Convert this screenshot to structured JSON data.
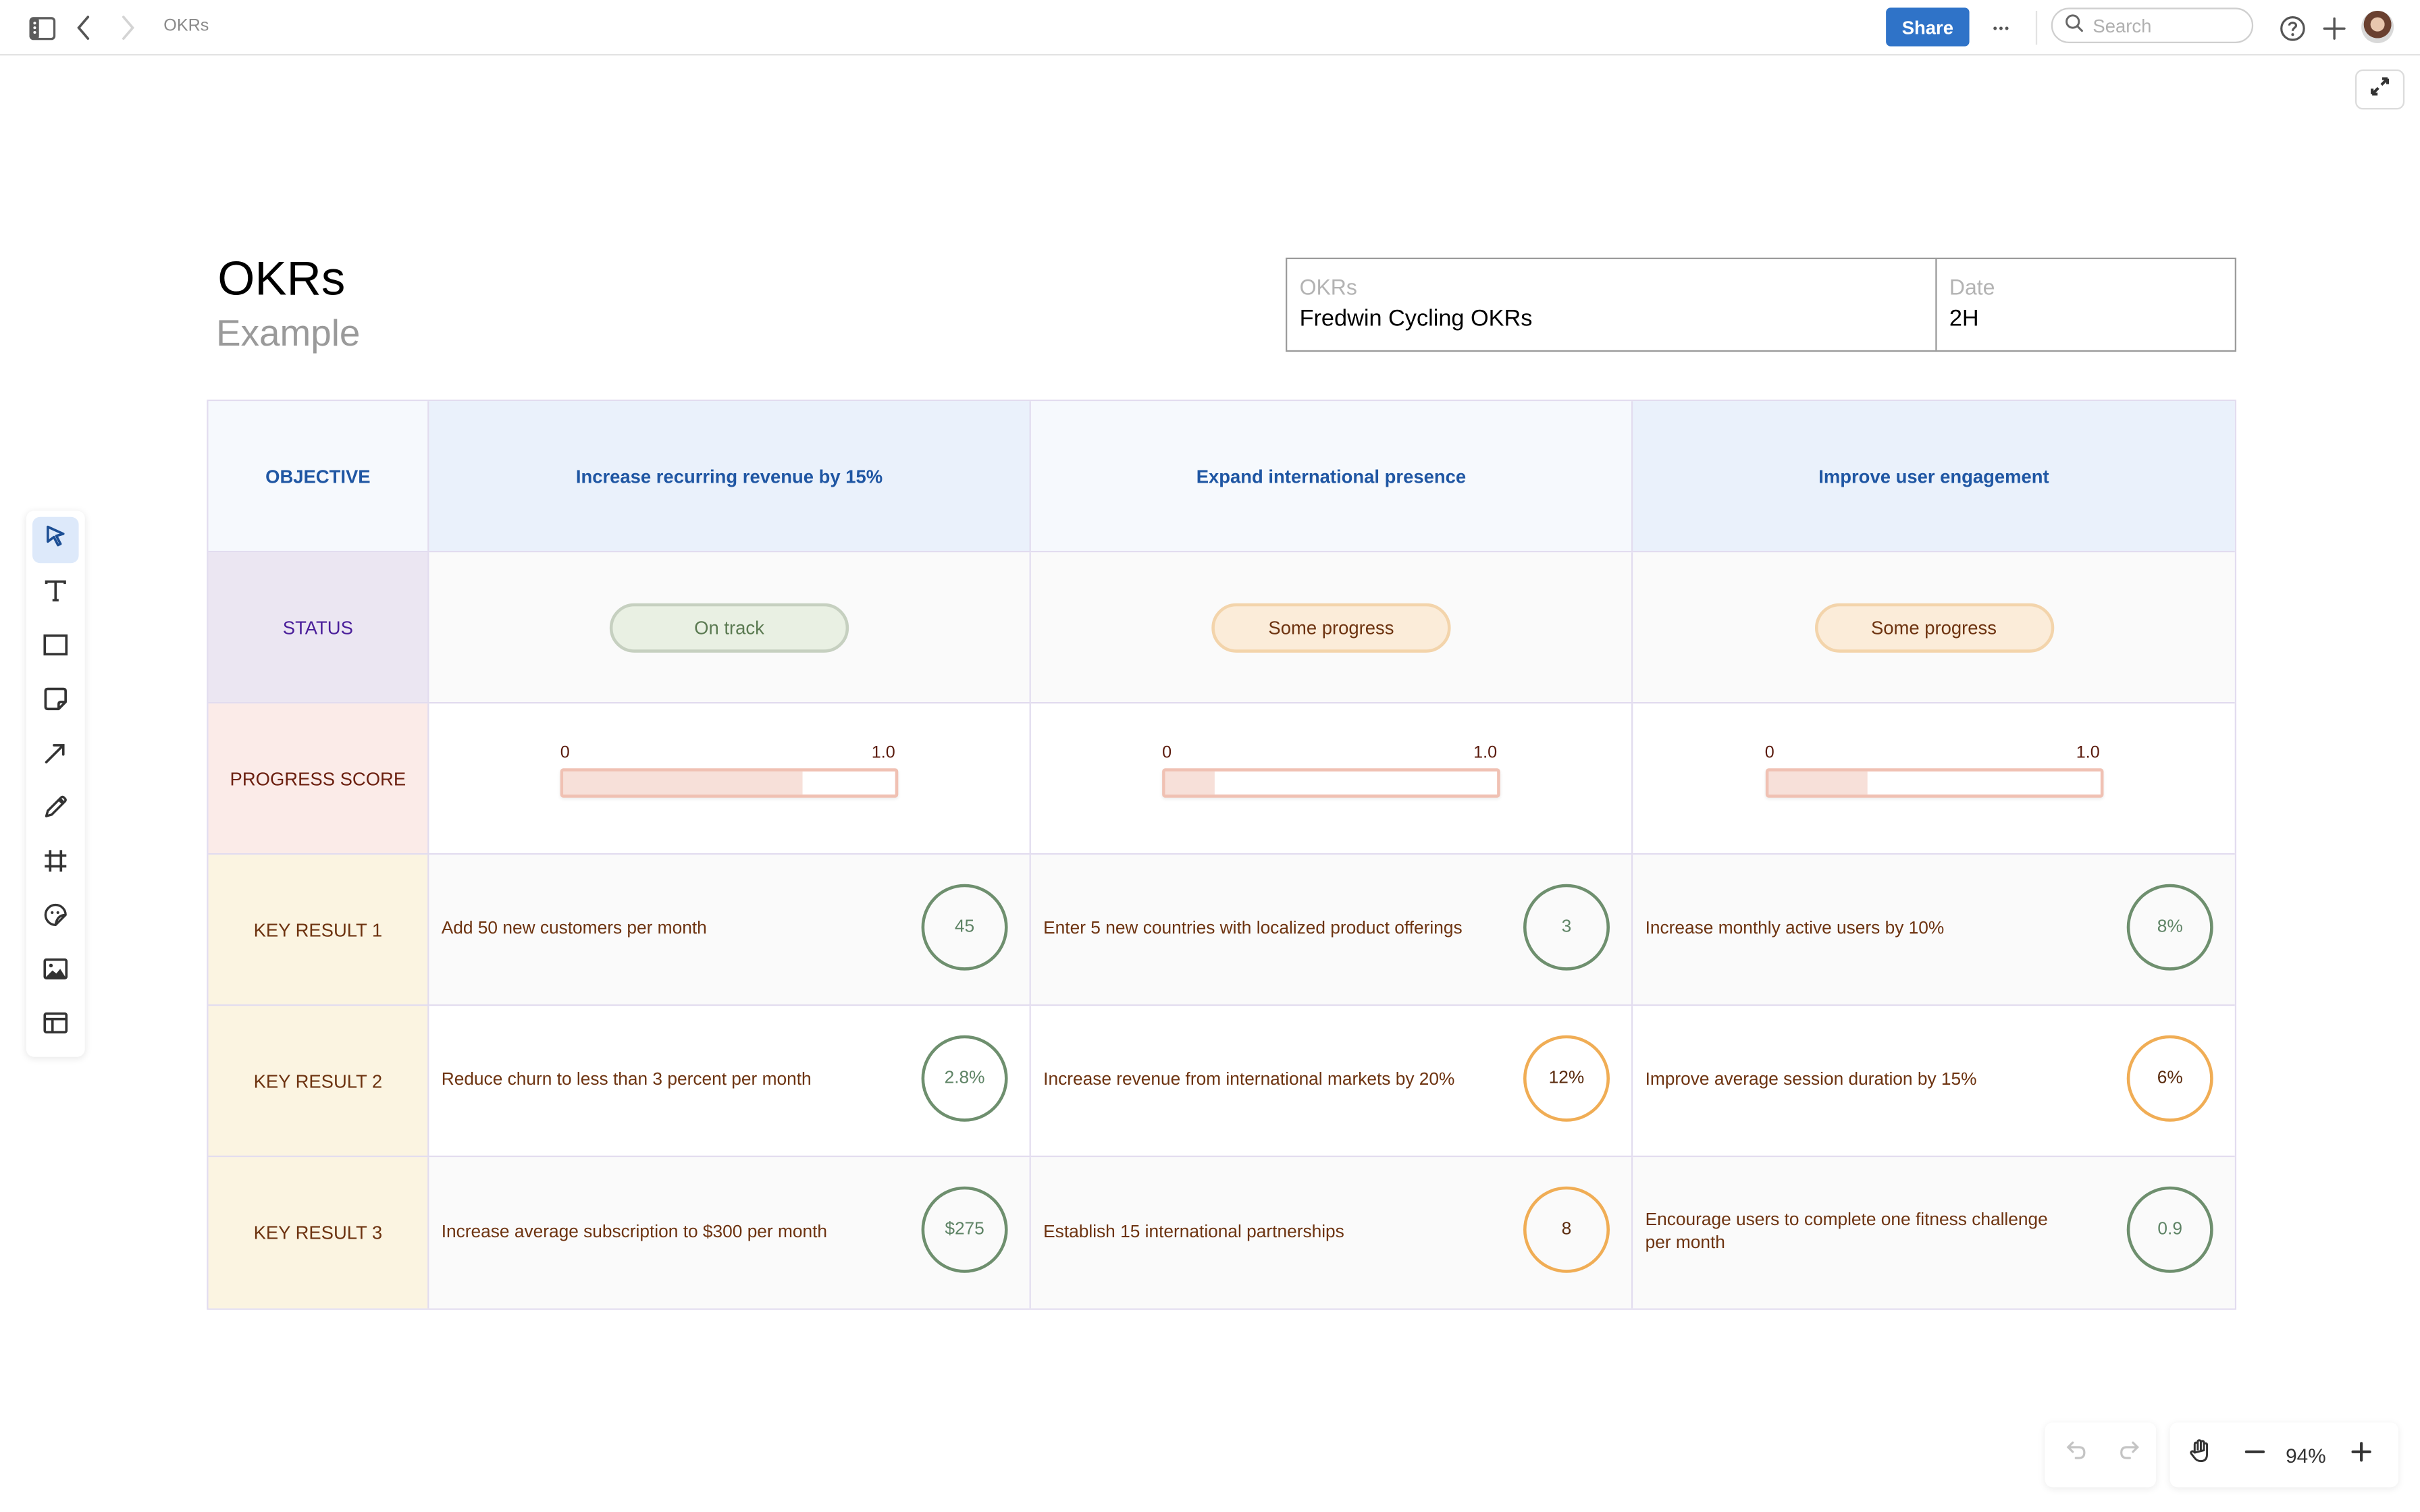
{
  "topbar": {
    "breadcrumb": "OKRs",
    "share_label": "Share",
    "more_label": "•••",
    "search_placeholder": "Search"
  },
  "document": {
    "title": "OKRs",
    "subtitle": "Example",
    "meta": {
      "okrs_label": "OKRs",
      "okrs_value": "Fredwin Cycling OKRs",
      "date_label": "Date",
      "date_value": "2H"
    }
  },
  "okr_table": {
    "row_labels": {
      "objective": "OBJECTIVE",
      "status": "STATUS",
      "progress": "PROGRESS SCORE",
      "kr1": "KEY RESULT 1",
      "kr2": "KEY RESULT 2",
      "kr3": "KEY RESULT 3"
    },
    "progress_scale": {
      "min_label": "0",
      "max_label": "1.0"
    },
    "objectives": [
      {
        "title": "Increase recurring revenue by 15%",
        "status": "On track",
        "status_tone": "green",
        "progress_score": 0.72,
        "key_results": [
          {
            "text": "Add 50 new customers per month",
            "value": "45",
            "tone": "green"
          },
          {
            "text": "Reduce churn to less than 3 percent per month",
            "value": "2.8%",
            "tone": "green"
          },
          {
            "text": "Increase average subscription to $300 per month",
            "value": "$275",
            "tone": "green"
          }
        ]
      },
      {
        "title": "Expand international presence",
        "status": "Some progress",
        "status_tone": "orange",
        "progress_score": 0.15,
        "key_results": [
          {
            "text": "Enter 5 new countries with localized product offerings",
            "value": "3",
            "tone": "green"
          },
          {
            "text": "Increase revenue from international markets by 20%",
            "value": "12%",
            "tone": "orange"
          },
          {
            "text": "Establish 15 international partnerships",
            "value": "8",
            "tone": "orange"
          }
        ]
      },
      {
        "title": "Improve user engagement",
        "status": "Some progress",
        "status_tone": "orange",
        "progress_score": 0.3,
        "key_results": [
          {
            "text": "Increase monthly active users by 10%",
            "value": "8%",
            "tone": "green"
          },
          {
            "text": "Improve average session duration by 15%",
            "value": "6%",
            "tone": "orange"
          },
          {
            "text": "Encourage users to complete one fitness challenge\n per month",
            "value": "0.9",
            "tone": "green"
          }
        ]
      }
    ]
  },
  "tools": [
    {
      "name": "select",
      "icon": "pointer-icon",
      "active": true
    },
    {
      "name": "text",
      "icon": "text-icon",
      "active": false
    },
    {
      "name": "shape",
      "icon": "rectangle-icon",
      "active": false
    },
    {
      "name": "sticky-note",
      "icon": "sticky-note-icon",
      "active": false
    },
    {
      "name": "arrow",
      "icon": "arrow-icon",
      "active": false
    },
    {
      "name": "pen",
      "icon": "pen-icon",
      "active": false
    },
    {
      "name": "frame",
      "icon": "frame-icon",
      "active": false
    },
    {
      "name": "sticker",
      "icon": "sticker-icon",
      "active": false
    },
    {
      "name": "image",
      "icon": "image-icon",
      "active": false
    },
    {
      "name": "template",
      "icon": "template-icon",
      "active": false
    }
  ],
  "bottom": {
    "zoom_level": "94%"
  },
  "colors": {
    "accent": "#2f73c8",
    "on_track": "#6e8f6e",
    "some_progress": "#f0ad55",
    "objective_text": "#1f56a3"
  }
}
